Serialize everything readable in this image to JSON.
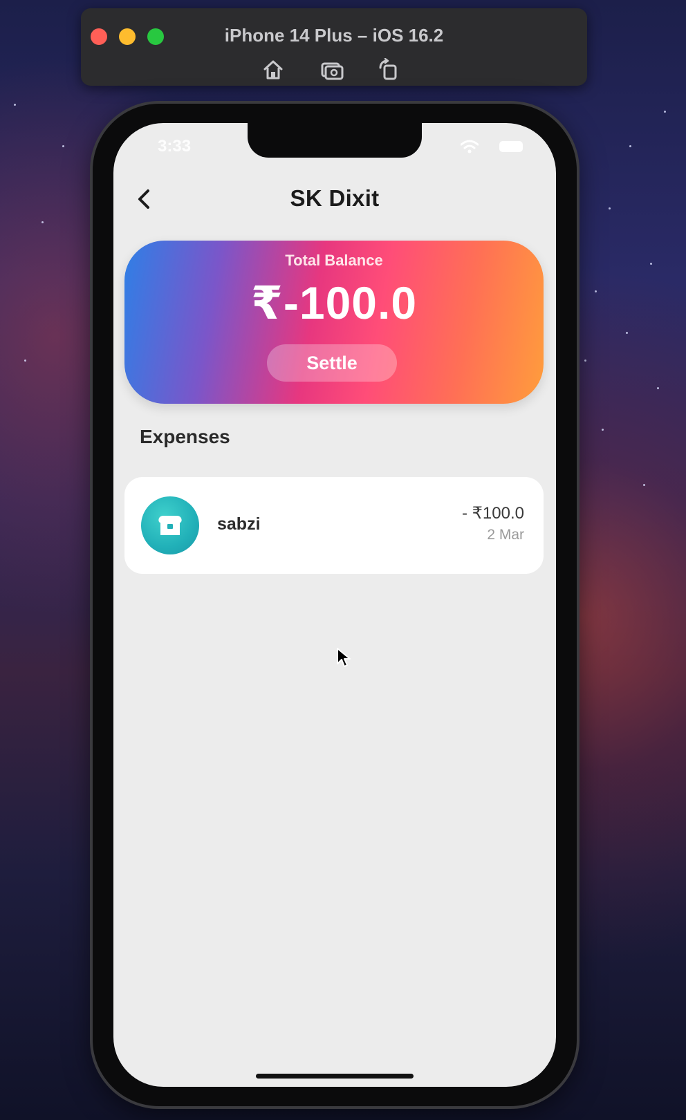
{
  "simulator": {
    "title": "iPhone 14 Plus – iOS 16.2",
    "icons": [
      "home-icon",
      "screenshot-icon",
      "rotate-icon"
    ]
  },
  "status_bar": {
    "time": "3:33"
  },
  "nav": {
    "title": "SK Dixit",
    "back_icon": "chevron-left-icon"
  },
  "balance": {
    "label": "Total Balance",
    "value": "₹-100.0",
    "settle_label": "Settle"
  },
  "expenses": {
    "title": "Expenses",
    "items": [
      {
        "name": "sabzi",
        "amount": "- ₹100.0",
        "date": "2 Mar",
        "icon": "bread-icon"
      }
    ]
  },
  "colors": {
    "gradient_start": "#2f7fe6",
    "gradient_mid": "#e7377f",
    "gradient_end": "#ff9d3c",
    "avatar": "#21b0b8",
    "screen_bg": "#ececec"
  }
}
